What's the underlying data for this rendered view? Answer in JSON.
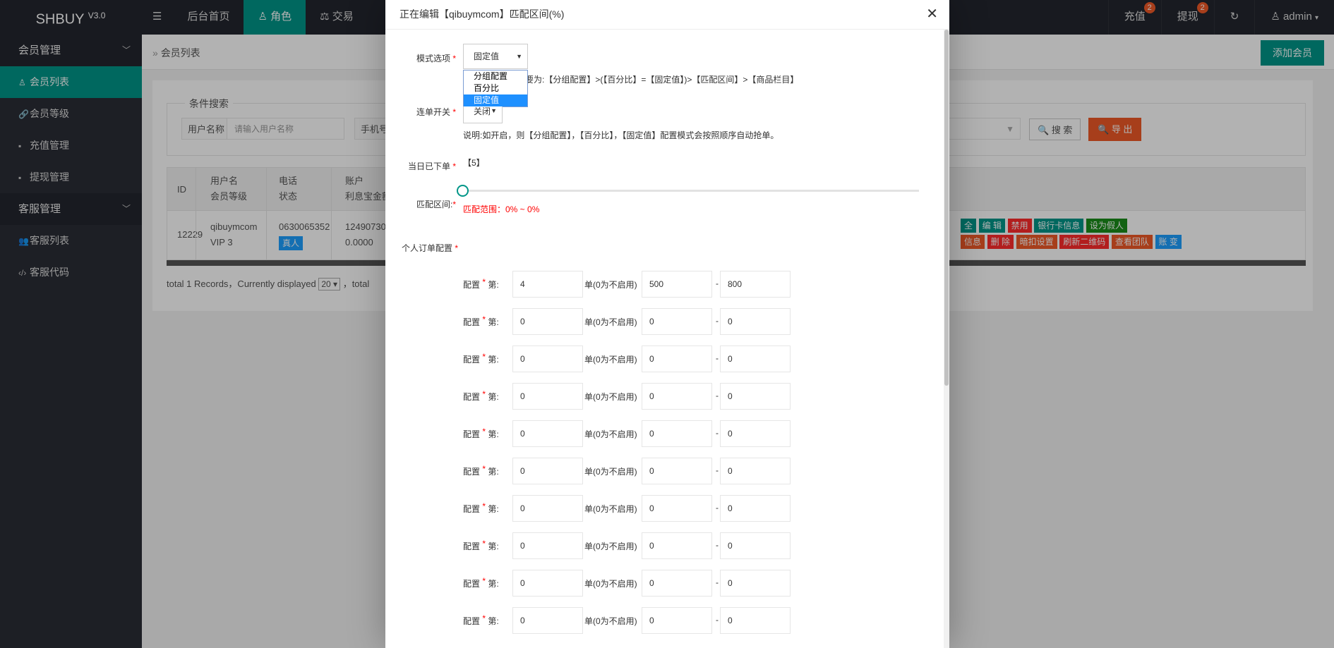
{
  "header": {
    "logo": "SHBUY",
    "version": "V3.0",
    "nav": [
      {
        "label": "后台首页",
        "icon": "home"
      },
      {
        "label": "角色",
        "icon": "user-icon"
      },
      {
        "label": "交易",
        "icon": "scale-icon"
      }
    ],
    "right": {
      "recharge": "充值",
      "recharge_badge": "2",
      "withdraw": "提现",
      "withdraw_badge": "2",
      "user": "admin"
    }
  },
  "sidebar": {
    "groups": [
      {
        "label": "会员管理",
        "items": [
          {
            "label": "会员列表",
            "icon": "user-icon"
          },
          {
            "label": "会员等级",
            "icon": "link-icon"
          },
          {
            "label": "充值管理",
            "icon": "chat-icon"
          },
          {
            "label": "提现管理",
            "icon": "chat-icon"
          }
        ]
      },
      {
        "label": "客服管理",
        "items": [
          {
            "label": "客服列表",
            "icon": "users-icon"
          },
          {
            "label": "客服代码",
            "icon": "code-icon"
          }
        ]
      }
    ]
  },
  "page": {
    "breadcrumb": "会员列表",
    "add_button": "添加会员",
    "search_legend": "条件搜索",
    "username_label": "用户名称",
    "username_placeholder": "请输入用户名称",
    "phone_label": "手机号",
    "search_button": "搜 索",
    "export_button": "导 出",
    "table": {
      "headers": [
        [
          "ID"
        ],
        [
          "用户名",
          "会员等级"
        ],
        [
          "电话",
          "状态"
        ],
        [
          "账户",
          "利息宝金额"
        ]
      ],
      "row": {
        "id": "12229",
        "username": "qibuymcom",
        "level": "VIP 3",
        "phone": "0630065352",
        "status": "真人",
        "account": "12490730",
        "interest": "0.0000"
      },
      "actions_row1": [
        "全",
        "编 辑",
        "禁用",
        "银行卡信息",
        "设为假人"
      ],
      "actions_row2": [
        "信息",
        "删 除",
        "暗扣设置",
        "刷新二维码",
        "查看团队",
        "账 变"
      ]
    },
    "footer": {
      "prefix": "total 1 Records，Currently displayed",
      "page_size": "20",
      "suffix": "，total"
    }
  },
  "modal": {
    "title": "正在编辑【qibuymcom】匹配区间(%)",
    "mode_label": "模式选项",
    "mode_value": "固定值",
    "mode_options": [
      "分组配置",
      "百分比",
      "固定值"
    ],
    "mode_note": "要为:【分组配置】>(【百分比】=【固定值】)>【匹配区间】>【商品栏目】",
    "chain_label": "连单开关",
    "chain_value": "关闭",
    "chain_note": "说明:如开启，则【分组配置】，【百分比】，【固定值】配置模式会按照顺序自动抢单。",
    "today_label": "当日已下单",
    "today_value": "【5】",
    "range_label": "匹配区间:",
    "range_text": "匹配范围：0% ~ 0%",
    "range_value_pct": 0,
    "personal_label": "个人订单配置",
    "cfg_label": "配置",
    "cfg_suffix": "第:",
    "cfg_unit": "单(0为不启用)",
    "cfg_dash": "-",
    "configs": [
      {
        "n": "4",
        "min": "500",
        "max": "800"
      },
      {
        "n": "0",
        "min": "0",
        "max": "0"
      },
      {
        "n": "0",
        "min": "0",
        "max": "0"
      },
      {
        "n": "0",
        "min": "0",
        "max": "0"
      },
      {
        "n": "0",
        "min": "0",
        "max": "0"
      },
      {
        "n": "0",
        "min": "0",
        "max": "0"
      },
      {
        "n": "0",
        "min": "0",
        "max": "0"
      },
      {
        "n": "0",
        "min": "0",
        "max": "0"
      },
      {
        "n": "0",
        "min": "0",
        "max": "0"
      },
      {
        "n": "0",
        "min": "0",
        "max": "0"
      }
    ]
  },
  "colors": {
    "accent": "#009688",
    "danger": "#f05a28",
    "sidebar": "#2a2d35",
    "header": "#23262e"
  }
}
